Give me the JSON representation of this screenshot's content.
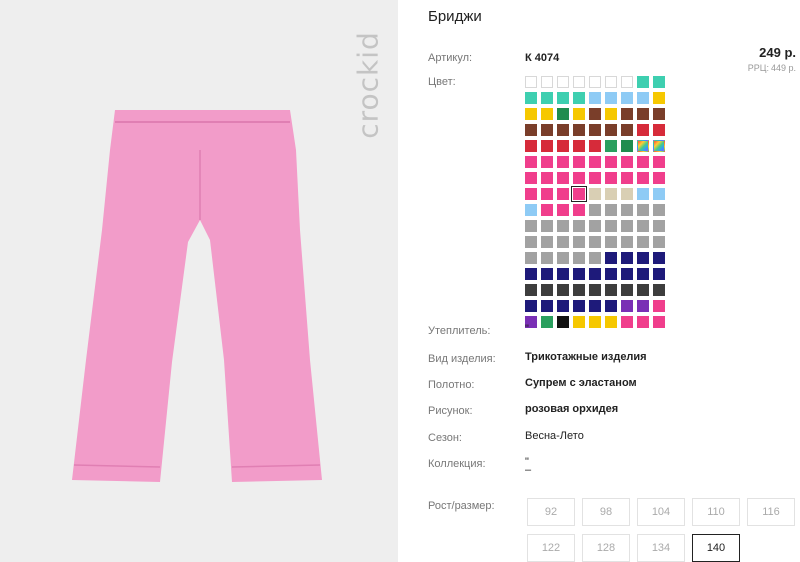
{
  "product": {
    "title": "Бриджи",
    "brand": "crockid",
    "article_label": "Артикул:",
    "article": "К 4074",
    "price": "249 р.",
    "rrp_label": "РРЦ:",
    "rrp": "449 р.",
    "color_label": "Цвет:",
    "fields": [
      {
        "label": "Утеплитель:",
        "value": "\"",
        "bold": false
      },
      {
        "label": "Вид изделия:",
        "value": "Трикотажные изделия",
        "bold": true
      },
      {
        "label": "Полотно:",
        "value": "Супрем с эластаном",
        "bold": true
      },
      {
        "label": "Рисунок:",
        "value": "розовая орхидея",
        "bold": true
      },
      {
        "label": "Сезон:",
        "value": "Весна-Лето",
        "bold": false
      },
      {
        "label": "Коллекция:",
        "value": "\"\n–",
        "bold": false
      }
    ],
    "sizes_label": "Рост/размер:",
    "sizes": [
      "92",
      "98",
      "104",
      "110",
      "116",
      "122",
      "128",
      "134",
      "140"
    ],
    "selected_size": "140",
    "pants_color": "#f29cc9",
    "swatch_rows": [
      [
        "empty",
        "empty",
        "empty",
        "empty",
        "empty",
        "empty",
        "empty",
        "#3ecfb0",
        "#3ecfb0"
      ],
      [
        "#3ecfb0",
        "#3ecfb0",
        "#3ecfb0",
        "#3ecfb0",
        "#8ecbf5",
        "#8ecbf5",
        "#8ecbf5",
        "#8ecbf5",
        "#f6c800"
      ],
      [
        "#f6c800",
        "#f6c800",
        "#1f8c4e",
        "#f6c800",
        "#7a3e2a",
        "#f6c800",
        "#7a3e2a",
        "#7a3e2a",
        "#7a3e2a"
      ],
      [
        "#7a3e2a",
        "#7a3e2a",
        "#7a3e2a",
        "#7a3e2a",
        "#7a3e2a",
        "#7a3e2a",
        "#7a3e2a",
        "#d62b3a",
        "#d62b3a"
      ],
      [
        "#d62b3a",
        "#d62b3a",
        "#d62b3a",
        "#d62b3a",
        "#d62b3a",
        "#2a9f5e",
        "#1f8c4e",
        "multi",
        "multi"
      ],
      [
        "#f03e8c",
        "#f03e8c",
        "#f03e8c",
        "#f03e8c",
        "#f03e8c",
        "#f03e8c",
        "#f03e8c",
        "#f03e8c",
        "#f03e8c"
      ],
      [
        "#f03e8c",
        "#f03e8c",
        "#f03e8c",
        "#f03e8c",
        "#f03e8c",
        "#f03e8c",
        "#f03e8c",
        "#f03e8c",
        "#f03e8c"
      ],
      [
        "#f03e8c",
        "#f03e8c",
        "#f03e8c",
        "#f03e8c",
        "#d9cfb4",
        "#d9cfb4",
        "#d9cfb4",
        "#8ecbf5",
        "#8ecbf5"
      ],
      [
        "#8ecbf5",
        "#f03e8c",
        "#f03e8c",
        "#f03e8c",
        "#a2a2a2",
        "#a2a2a2",
        "#a2a2a2",
        "#a2a2a2",
        "#a2a2a2"
      ],
      [
        "#a2a2a2",
        "#a2a2a2",
        "#a2a2a2",
        "#a2a2a2",
        "#a2a2a2",
        "#a2a2a2",
        "#a2a2a2",
        "#a2a2a2",
        "#a2a2a2"
      ],
      [
        "#a2a2a2",
        "#a2a2a2",
        "#a2a2a2",
        "#a2a2a2",
        "#a2a2a2",
        "#a2a2a2",
        "#a2a2a2",
        "#a2a2a2",
        "#a2a2a2"
      ],
      [
        "#a2a2a2",
        "#a2a2a2",
        "#a2a2a2",
        "#a2a2a2",
        "#a2a2a2",
        "#1e1a7a",
        "#1e1a7a",
        "#1e1a7a",
        "#1e1a7a"
      ],
      [
        "#1e1a7a",
        "#1e1a7a",
        "#1e1a7a",
        "#1e1a7a",
        "#1e1a7a",
        "#1e1a7a",
        "#1e1a7a",
        "#1e1a7a",
        "#1e1a7a"
      ],
      [
        "#3d3d3d",
        "#3d3d3d",
        "#3d3d3d",
        "#3d3d3d",
        "#3d3d3d",
        "#3d3d3d",
        "#3d3d3d",
        "#3d3d3d",
        "#3d3d3d"
      ],
      [
        "#1e1a7a",
        "#1e1a7a",
        "#1e1a7a",
        "#1e1a7a",
        "#1e1a7a",
        "#1e1a7a",
        "#7a2fb5",
        "#7a2fb5",
        "#f03e8c"
      ],
      [
        "#7a2fb5",
        "#2a9f5e",
        "#111111",
        "#f6c800",
        "#f6c800",
        "#f6c800",
        "#f03e8c",
        "#f03e8c",
        "#f03e8c"
      ]
    ],
    "selected_swatch": [
      7,
      3
    ]
  }
}
